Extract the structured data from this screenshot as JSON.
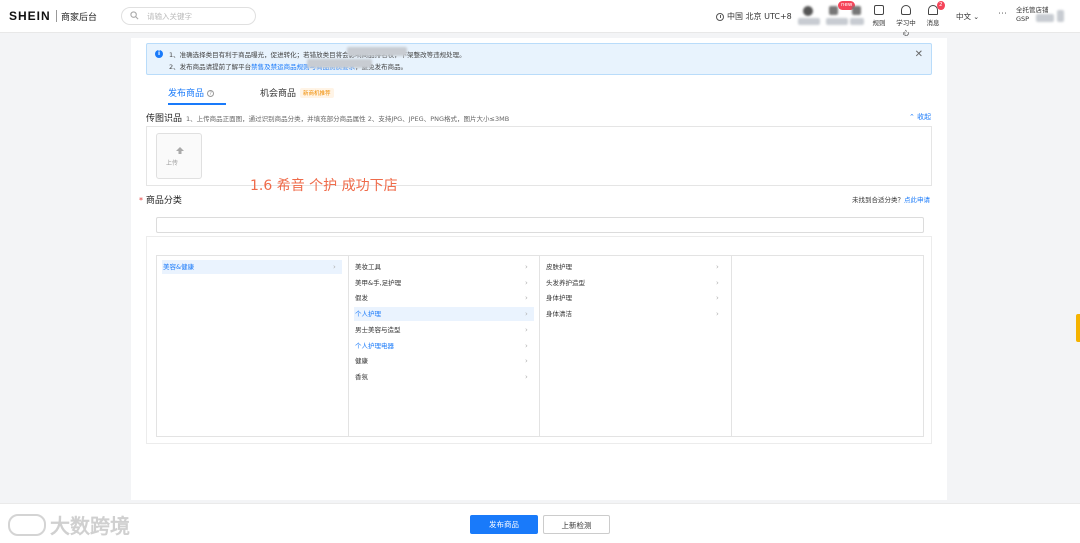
{
  "header": {
    "logo": "SHEIN",
    "subtitle": "商家后台",
    "search_placeholder": "请输入关键字",
    "timezone": "中国 北京 UTC+8",
    "tools": [
      {
        "label": "规则"
      },
      {
        "label": "学习中心"
      },
      {
        "label": "消息"
      }
    ],
    "badge_new": "new",
    "badge_msg": "2",
    "language": "中文",
    "user_name": "全托管店铺",
    "user_sub": "GSP"
  },
  "notice": {
    "line1": "1、准确选择类目有利于商品曝光，促进转化；若错放类目将会影响商品排名权，下架整改等违规处理。",
    "line2_prefix": "2、发布商品请提前了解平台",
    "line2_link": "禁售及禁运商品规则与商品资质要求",
    "line2_suffix": "，避免发布商品。"
  },
  "tabs": {
    "publish": "发布商品",
    "opportunity": "机会商品",
    "opportunity_tag": "新商机推荐"
  },
  "image_recognition": {
    "title": "传图识品",
    "description": "1、上传商品正面图，通过识别商品分类，并填充部分商品属性   2、支持JPG、JPEG、PNG格式，图片大小≤3MB",
    "collapse": "收起",
    "upload_label": "上传"
  },
  "annotation": "1.6  希音 个护 成功下店",
  "category": {
    "title": "商品分类",
    "help_text": "未找到合适分类？",
    "help_link": "点此申请",
    "columns": [
      {
        "items": [
          {
            "label": "美容&健康",
            "selected": true
          }
        ]
      },
      {
        "items": [
          {
            "label": "美妆工具",
            "selected": false
          },
          {
            "label": "美甲&手,足护理",
            "selected": false
          },
          {
            "label": "假发",
            "selected": false
          },
          {
            "label": "个人护理",
            "selected": true
          },
          {
            "label": "男士美容与造型",
            "selected": false
          },
          {
            "label": "个人护理电器",
            "selected": false
          },
          {
            "label": "健康",
            "selected": false
          },
          {
            "label": "香氛",
            "selected": false
          }
        ]
      },
      {
        "items": [
          {
            "label": "皮肤护理",
            "selected": false
          },
          {
            "label": "头发养护造型",
            "selected": false
          },
          {
            "label": "身体护理",
            "selected": false
          },
          {
            "label": "身体清洁",
            "selected": false
          }
        ]
      }
    ]
  },
  "footer": {
    "publish_button": "发布商品",
    "check_button": "上新检测",
    "watermark": "大数跨境"
  },
  "colors": {
    "primary": "#197afa",
    "annotation": "#ef6b4a",
    "badge": "#f5455a"
  }
}
